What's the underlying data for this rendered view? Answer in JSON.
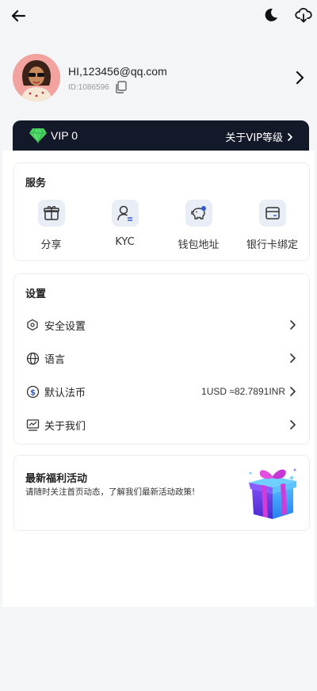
{
  "header": {
    "back_icon": "arrow-left-icon",
    "theme_icon": "moon-icon",
    "download_icon": "cloud-download-icon"
  },
  "profile": {
    "email": "HI,123456@qq.com",
    "uid": "ID:1086596"
  },
  "vip": {
    "level": "VIP 0",
    "link": "关于VIP等级"
  },
  "services": {
    "title": "服务",
    "items": [
      {
        "label": "分享",
        "icon": "gift-icon"
      },
      {
        "label": "KYC",
        "icon": "user-verify-icon"
      },
      {
        "label": "钱包地址",
        "icon": "piggy-bank-icon"
      },
      {
        "label": "银行卡绑定",
        "icon": "bank-card-icon"
      }
    ]
  },
  "settings": {
    "title": "设置",
    "items": [
      {
        "label": "安全设置",
        "icon": "shield-hex-icon",
        "value": ""
      },
      {
        "label": "语言",
        "icon": "globe-icon",
        "value": ""
      },
      {
        "label": "默认法币",
        "icon": "dollar-icon",
        "value": "1USD ≈82.7891INR"
      },
      {
        "label": "关于我们",
        "icon": "monitor-chart-icon",
        "value": ""
      }
    ]
  },
  "promo": {
    "title": "最新福利活动",
    "subtitle": "请随时关注首页动态，了解我们最新活动政策!"
  },
  "colors": {
    "accent": "#2f5bd8",
    "vip_bg": "#14192a",
    "page_bg": "#f3f5f7"
  }
}
